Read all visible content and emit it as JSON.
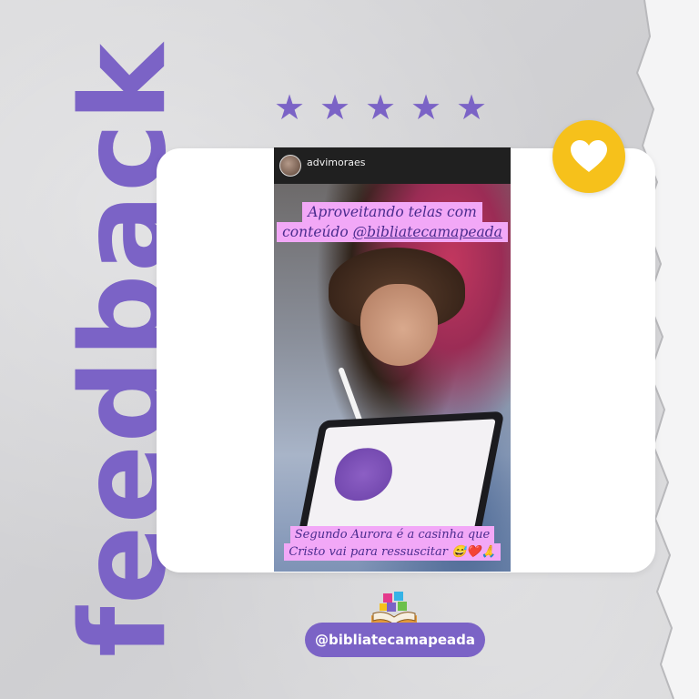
{
  "title": "feedback",
  "rating": {
    "stars": 5,
    "max": 5
  },
  "story": {
    "username": "advimoraes",
    "caption_top": {
      "line1": "Aproveitando telas com",
      "line2_prefix": "conteúdo ",
      "line2_handle": "@bibliatecamapeada"
    },
    "caption_bottom": {
      "line1": "Segundo Aurora é a casinha que",
      "line2": "Cristo vai para ressuscitar 😅❤️🙏"
    }
  },
  "footer": {
    "handle": "@bibliatecamapeada"
  },
  "icons": {
    "badge": "heart-icon",
    "logo": "open-book-puzzle-icon",
    "rating": "star-icon"
  },
  "colors": {
    "accent": "#7b63c6",
    "badge": "#f6c11b",
    "caption_highlight": "#f2a8f7",
    "background": "#d6d6d8"
  }
}
